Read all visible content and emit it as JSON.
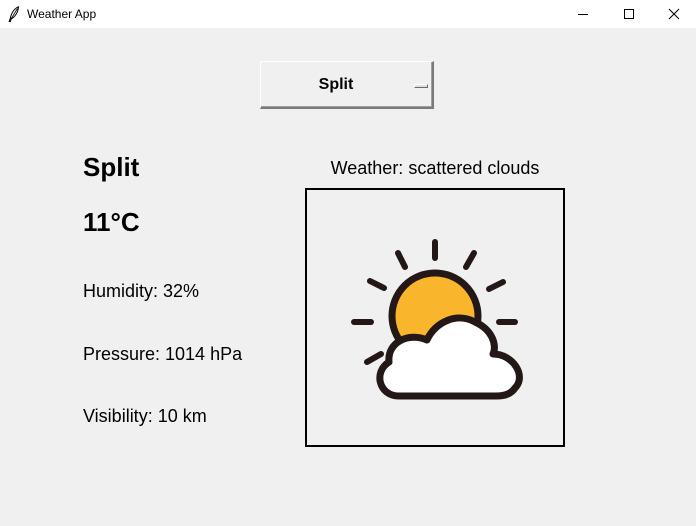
{
  "window": {
    "title": "Weather App"
  },
  "selector": {
    "selected_city": "Split"
  },
  "weather": {
    "city": "Split",
    "temperature": "11°C",
    "humidity": "Humidity: 32%",
    "pressure": "Pressure: 1014 hPa",
    "visibility": "Visibility: 10 km",
    "description": "Weather: scattered clouds",
    "icon": "partly-cloudy-icon"
  },
  "colors": {
    "window_bg": "#f0f0f0",
    "sun": "#f9b52c",
    "cloud": "#ffffff",
    "outline": "#231815"
  }
}
